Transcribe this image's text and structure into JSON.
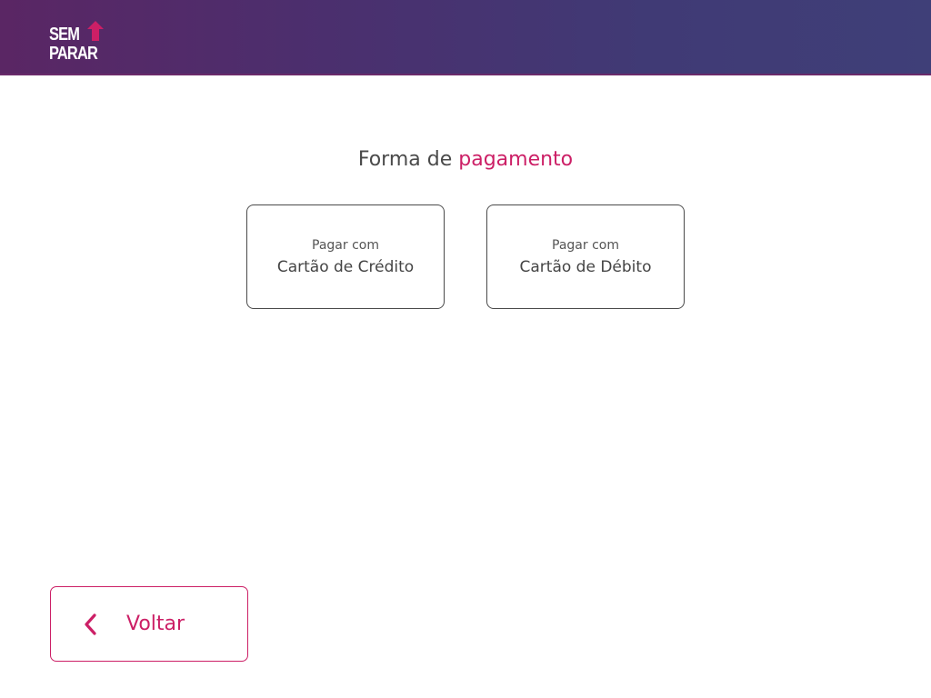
{
  "brand": {
    "logo_line1": "SEM",
    "logo_line2": "PARAR",
    "accent_color": "#cc1f66",
    "header_gradient": [
      "#5a2664",
      "#3f3f78"
    ]
  },
  "main": {
    "title_prefix": "Forma de",
    "title_accent": "pagamento",
    "options": [
      {
        "small": "Pagar com",
        "big": "Cartão de Crédito"
      },
      {
        "small": "Pagar com",
        "big": "Cartão de Débito"
      }
    ]
  },
  "footer": {
    "back_label": "Voltar",
    "back_icon": "chevron-left-icon"
  }
}
